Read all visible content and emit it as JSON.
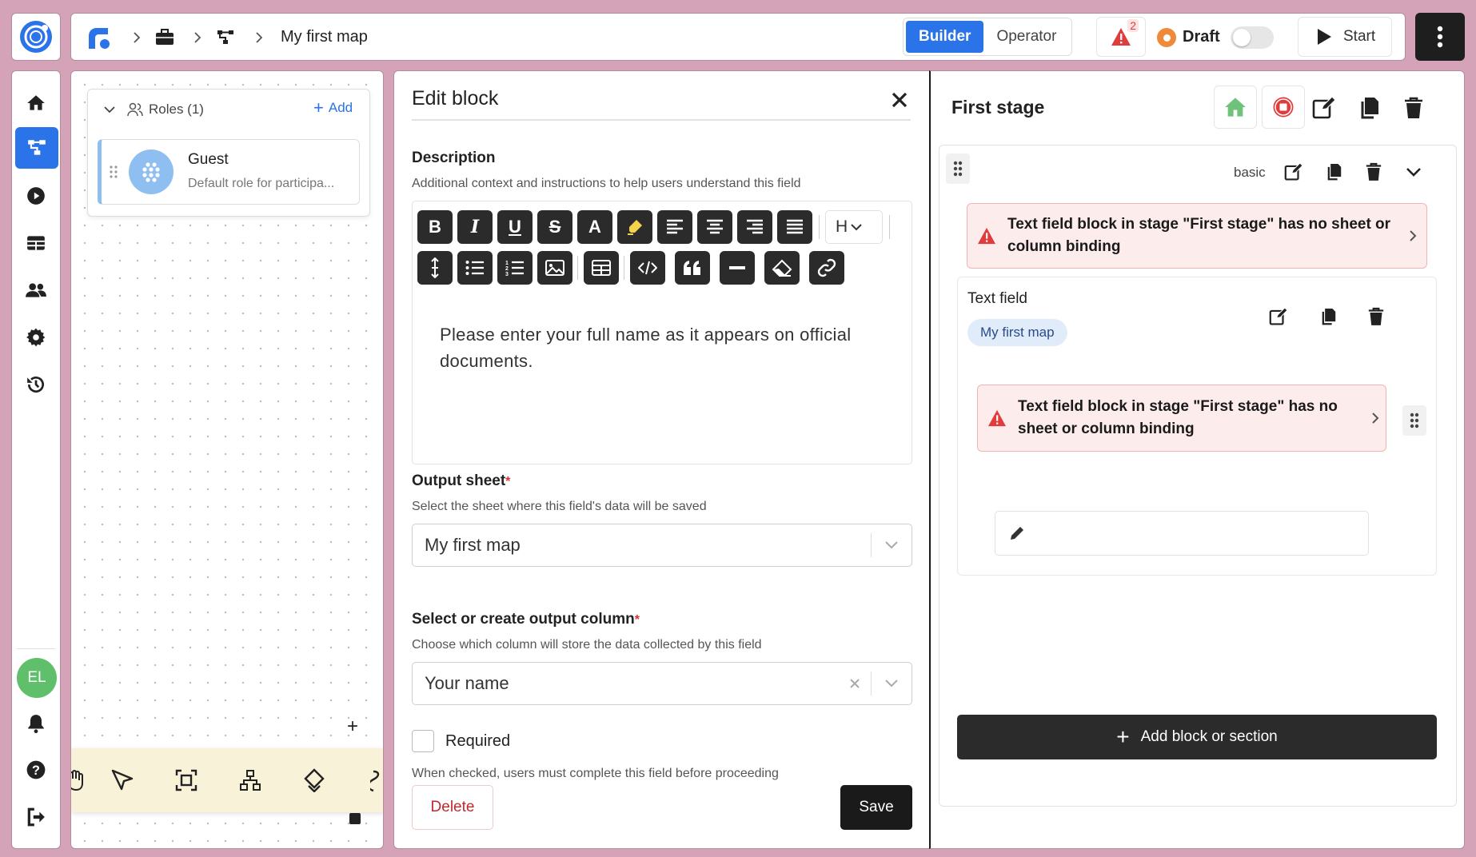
{
  "topbar": {
    "breadcrumb": [
      "My first map"
    ],
    "mode_builder": "Builder",
    "mode_operator": "Operator",
    "alert_count": "2",
    "status_label": "Draft",
    "start_label": "Start"
  },
  "sidebar": {
    "avatar_initials": "EL"
  },
  "roles": {
    "header": "Roles (1)",
    "add_label": "Add",
    "items": [
      {
        "name": "Guest",
        "description": "Default role for participa..."
      }
    ]
  },
  "edit_block": {
    "title": "Edit block",
    "description_label": "Description",
    "description_help": "Additional context and instructions to help users understand this field",
    "heading_button": "H",
    "editor_text": "Please enter your full name as it appears on official documents.",
    "output_sheet_label": "Output sheet",
    "output_sheet_help": "Select the sheet where this field's data will be saved",
    "output_sheet_value": "My first map",
    "output_column_label": "Select or create output column",
    "output_column_help": "Choose which column will store the data collected by this field",
    "output_column_value": "Your name",
    "required_label": "Required",
    "required_help": "When checked, users must complete this field before proceeding",
    "required_checked": false,
    "delete_label": "Delete",
    "save_label": "Save"
  },
  "stage": {
    "title": "First stage",
    "section_label": "basic",
    "warning_1": "Text field block in stage \"First stage\" has no sheet or column binding",
    "block_title": "Text field",
    "block_tag": "My first map",
    "warning_2": "Text field block in stage \"First stage\" has no sheet or column binding",
    "add_block_label": "Add block or section"
  },
  "colors": {
    "background": "#d4a3b8",
    "accent_blue": "#2b73e8",
    "dark": "#2b2b2b",
    "warning_bg": "#fdecec",
    "warning_red": "#e03c3c"
  }
}
